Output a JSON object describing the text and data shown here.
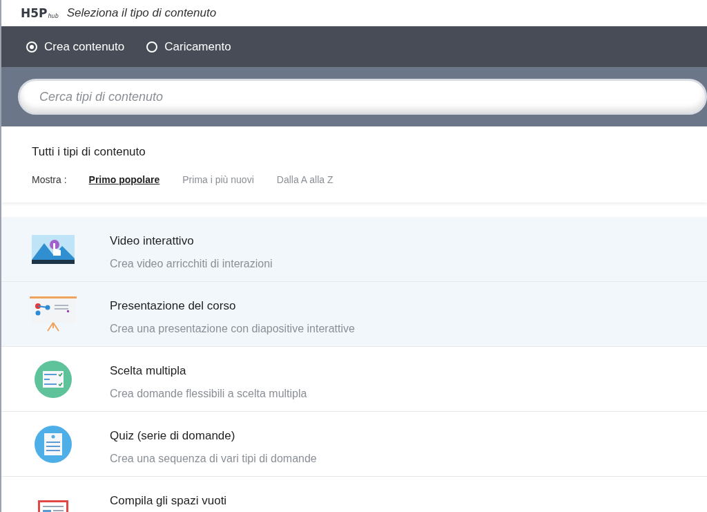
{
  "header": {
    "logo": "H5P",
    "logo_sub": "hub",
    "title": "Seleziona il tipo di contenuto"
  },
  "modes": [
    {
      "label": "Crea contenuto",
      "selected": true
    },
    {
      "label": "Caricamento",
      "selected": false
    }
  ],
  "search": {
    "placeholder": "Cerca tipi di contenuto"
  },
  "section_title": "Tutti i tipi di contenuto",
  "sort": {
    "label": "Mostra :",
    "options": [
      {
        "label": "Primo popolare",
        "selected": true
      },
      {
        "label": "Prima i più nuovi",
        "selected": false
      },
      {
        "label": "Dalla A alla Z",
        "selected": false
      }
    ]
  },
  "content_types": [
    {
      "kind": "video",
      "title": "Video interattivo",
      "description": "Crea video arricchiti di interazioni",
      "highlighted": true
    },
    {
      "kind": "presentation",
      "title": "Presentazione del corso",
      "description": "Crea una presentazione con diapositive interattive",
      "highlighted": true
    },
    {
      "kind": "multichoice",
      "title": "Scelta multipla",
      "description": "Crea domande flessibili a scelta multipla",
      "highlighted": false
    },
    {
      "kind": "quiz",
      "title": "Quiz (serie di domande)",
      "description": "Crea una sequenza di vari tipi di domande",
      "highlighted": false
    },
    {
      "kind": "fillblanks",
      "title": "Compila gli spazi vuoti",
      "highlighted": false
    }
  ]
}
